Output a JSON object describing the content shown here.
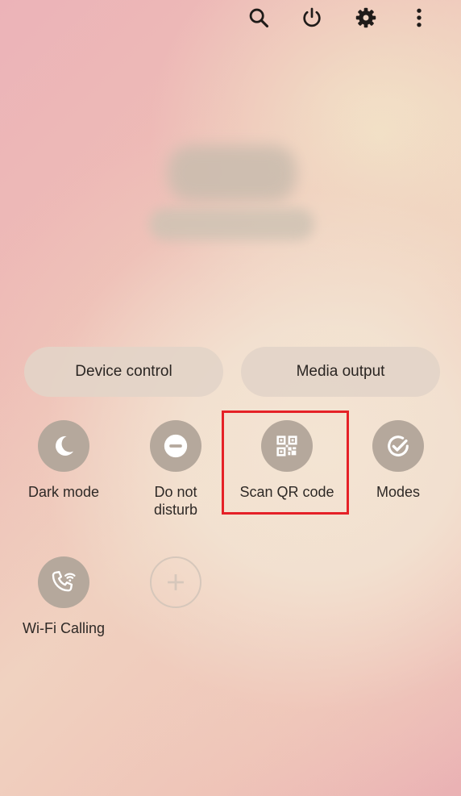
{
  "top_bar": {
    "icons": [
      "search-icon",
      "power-icon",
      "gear-icon",
      "more-vert-icon"
    ]
  },
  "buttons": {
    "device_control": "Device control",
    "media_output": "Media output"
  },
  "tiles": [
    {
      "label": "Dark mode",
      "icon": "moon-icon"
    },
    {
      "label": "Do not\ndisturb",
      "icon": "minus-circle-icon"
    },
    {
      "label": "Scan QR code",
      "icon": "qr-code-icon"
    },
    {
      "label": "Modes",
      "icon": "check-circle-icon"
    },
    {
      "label": "Wi-Fi Calling",
      "icon": "wifi-calling-icon"
    },
    {
      "label": "",
      "icon": "plus-icon"
    }
  ],
  "colors": {
    "highlight": "#e52127",
    "tile_circle": "#b5a89c",
    "pill_bg": "#e2d4c8"
  }
}
